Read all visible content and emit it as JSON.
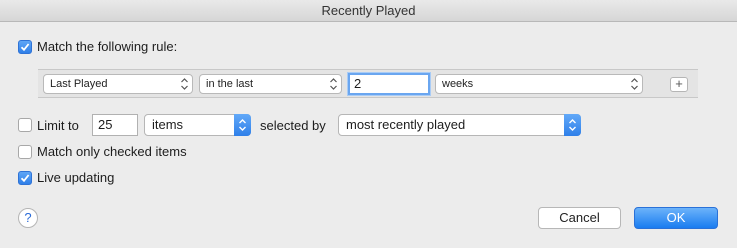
{
  "window": {
    "title": "Recently Played"
  },
  "match_rule": {
    "checked": true,
    "label": "Match the following rule:"
  },
  "rule": {
    "field": "Last Played",
    "operator": "in the last",
    "value": "2",
    "unit": "weeks",
    "add_label": "+"
  },
  "limit": {
    "checked": false,
    "label": "Limit to",
    "value": "25",
    "unit": "items",
    "selected_by_label": "selected by",
    "selected_by": "most recently played"
  },
  "checked_only": {
    "checked": false,
    "label": "Match only checked items"
  },
  "live_updating": {
    "checked": true,
    "label": "Live updating"
  },
  "help": {
    "label": "?"
  },
  "buttons": {
    "cancel": "Cancel",
    "ok": "OK"
  },
  "colors": {
    "accent": "#2f7fe8",
    "window_bg": "#ececec"
  }
}
